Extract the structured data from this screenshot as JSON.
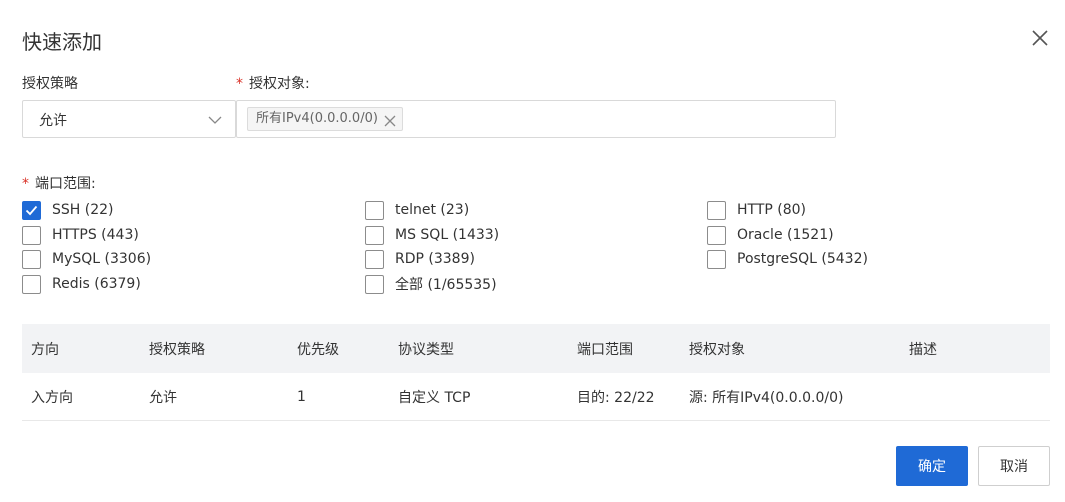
{
  "dialog": {
    "title": "快速添加"
  },
  "policy": {
    "label": "授权策略",
    "value": "允许"
  },
  "target": {
    "label": "授权对象:",
    "tags": [
      "所有IPv4(0.0.0.0/0)"
    ]
  },
  "ports": {
    "label": "端口范围:",
    "options": [
      {
        "label": "SSH (22)",
        "checked": true
      },
      {
        "label": "telnet (23)",
        "checked": false
      },
      {
        "label": "HTTP (80)",
        "checked": false
      },
      {
        "label": "HTTPS (443)",
        "checked": false
      },
      {
        "label": "MS SQL (1433)",
        "checked": false
      },
      {
        "label": "Oracle (1521)",
        "checked": false
      },
      {
        "label": "MySQL (3306)",
        "checked": false
      },
      {
        "label": "RDP (3389)",
        "checked": false
      },
      {
        "label": "PostgreSQL (5432)",
        "checked": false
      },
      {
        "label": "Redis (6379)",
        "checked": false
      },
      {
        "label": "全部 (1/65535)",
        "checked": false
      }
    ]
  },
  "table": {
    "columns": [
      "方向",
      "授权策略",
      "优先级",
      "协议类型",
      "端口范围",
      "授权对象",
      "描述"
    ],
    "rows": [
      [
        "入方向",
        "允许",
        "1",
        "自定义 TCP",
        "目的: 22/22",
        "源: 所有IPv4(0.0.0.0/0)",
        ""
      ]
    ]
  },
  "footer": {
    "confirm": "确定",
    "cancel": "取消"
  },
  "colors": {
    "primary": "#1f6ad6",
    "required": "#d93026",
    "header_bg": "#f2f3f5"
  }
}
